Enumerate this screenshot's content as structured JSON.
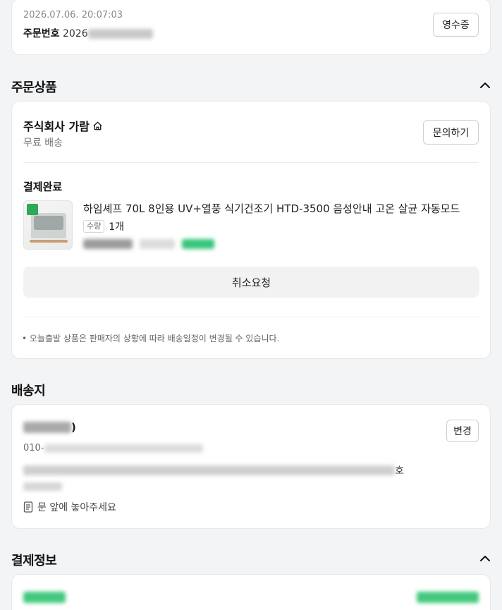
{
  "order": {
    "datetime": "2026.07.06. 20:07:03",
    "number_label": "주문번호",
    "number_visible": "2026",
    "receipt_button": "영수증"
  },
  "sections": {
    "order_items": "주문상품",
    "delivery": "배송지",
    "payment": "결제정보"
  },
  "seller": {
    "name": "주식회사 가람",
    "shipping": "무료 배송",
    "inquiry_button": "문의하기"
  },
  "item": {
    "status": "결제완료",
    "title": "하임셰프 70L 8인용 UV+열풍 식기건조기 HTD-3500 음성안내 고온 살균 자동모드",
    "qty_badge": "수량",
    "qty": "1개",
    "cancel_button": "취소요청"
  },
  "notice": "• 오늘출발 상품은 판매자의 상황에 따라 배송일정이 변경될 수 있습니다.",
  "address": {
    "name_suffix": ")",
    "phone_prefix": "010-",
    "change_button": "변경",
    "address_suffix": "호",
    "memo": "문 앞에 놓아주세요"
  },
  "colors": {
    "accent_green": "#03c75a",
    "border": "#e8e8e8"
  }
}
